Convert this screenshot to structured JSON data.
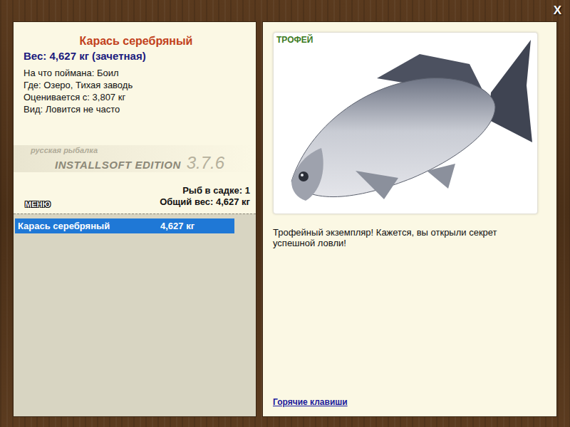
{
  "close": "X",
  "fish": {
    "name": "Карась серебряный",
    "weight": "Вес: 4,627 кг (зачетная)",
    "details": [
      "На что поймана: Боил",
      "Где: Озеро, Тихая заводь",
      "Оценивается с: 3,807 кг",
      "Вид: Ловится не часто"
    ]
  },
  "logo": {
    "line1": "русская рыбалка",
    "line2": "INSTALLSOFT EDITION",
    "version": "3.7.6"
  },
  "keepnet": {
    "count": "Рыб в садке: 1",
    "total": "Общий вес: 4,627 кг"
  },
  "menu_button": "МЕНЮ",
  "catch_list": [
    {
      "name": "Карась серебряный",
      "weight": "4,627 кг",
      "selected": true
    }
  ],
  "photo": {
    "badge": "ТРОФЕЙ"
  },
  "message": "Трофейный экземпляр! Кажется, вы открыли секрет успешной ловли!",
  "hotkeys_link": "Горячие клавиши"
}
